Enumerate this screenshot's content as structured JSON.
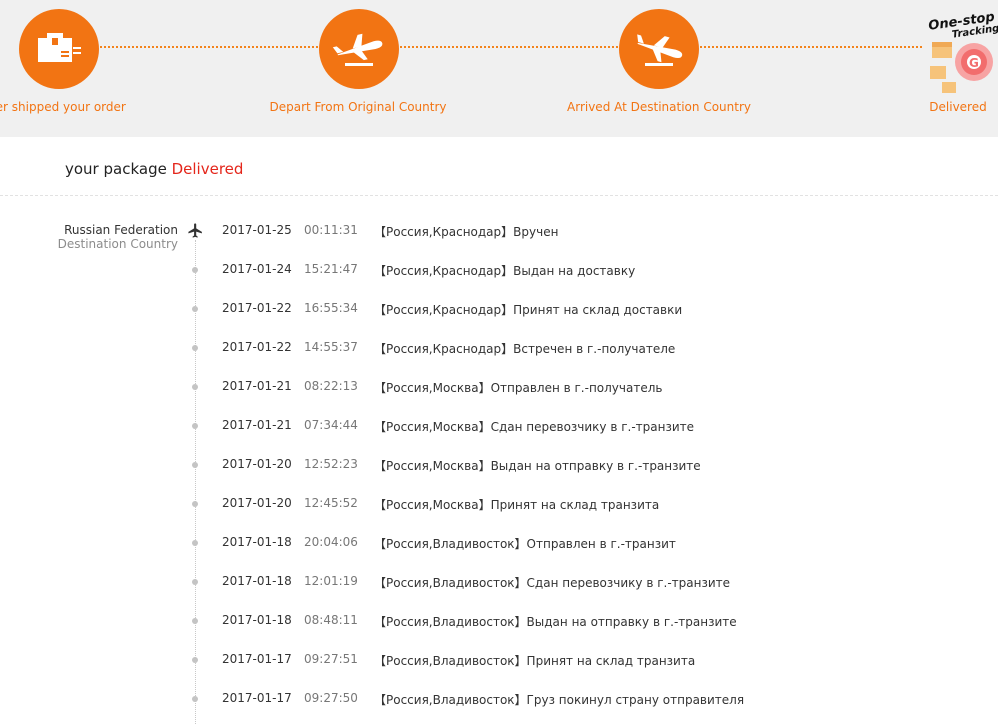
{
  "progress": {
    "steps": [
      {
        "label": "Seller shipped your order",
        "icon": "package-icon"
      },
      {
        "label": "Depart From Original Country",
        "icon": "plane-takeoff-icon"
      },
      {
        "label": "Arrived At Destination Country",
        "icon": "plane-landing-icon"
      },
      {
        "label": "Delivered",
        "icon": "one-stop-tracking-logo"
      }
    ],
    "badge": {
      "line1": "One-stop",
      "line2": "Tracking"
    },
    "accent_color": "#f27413"
  },
  "status": {
    "prefix": "your package ",
    "value": "Delivered",
    "value_color": "#e4261b"
  },
  "location": {
    "country": "Russian Federation",
    "label": "Destination Country"
  },
  "events": [
    {
      "date": "2017-01-25",
      "time": "00:11:31",
      "desc": "【Россия,Краснодар】Вручен"
    },
    {
      "date": "2017-01-24",
      "time": "15:21:47",
      "desc": "【Россия,Краснодар】Выдан на доставку"
    },
    {
      "date": "2017-01-22",
      "time": "16:55:34",
      "desc": "【Россия,Краснодар】Принят на склад доставки"
    },
    {
      "date": "2017-01-22",
      "time": "14:55:37",
      "desc": "【Россия,Краснодар】Встречен в г.-получателе"
    },
    {
      "date": "2017-01-21",
      "time": "08:22:13",
      "desc": "【Россия,Москва】Отправлен в г.-получатель"
    },
    {
      "date": "2017-01-21",
      "time": "07:34:44",
      "desc": "【Россия,Москва】Сдан перевозчику в г.-транзите"
    },
    {
      "date": "2017-01-20",
      "time": "12:52:23",
      "desc": "【Россия,Москва】Выдан на отправку в г.-транзите"
    },
    {
      "date": "2017-01-20",
      "time": "12:45:52",
      "desc": "【Россия,Москва】Принят на склад транзита"
    },
    {
      "date": "2017-01-18",
      "time": "20:04:06",
      "desc": "【Россия,Владивосток】Отправлен в г.-транзит"
    },
    {
      "date": "2017-01-18",
      "time": "12:01:19",
      "desc": "【Россия,Владивосток】Сдан перевозчику в г.-транзите"
    },
    {
      "date": "2017-01-18",
      "time": "08:48:11",
      "desc": "【Россия,Владивосток】Выдан на отправку в г.-транзите"
    },
    {
      "date": "2017-01-17",
      "time": "09:27:51",
      "desc": "【Россия,Владивосток】Принят на склад транзита"
    },
    {
      "date": "2017-01-17",
      "time": "09:27:50",
      "desc": "【Россия,Владивосток】Груз покинул страну отправителя"
    }
  ]
}
